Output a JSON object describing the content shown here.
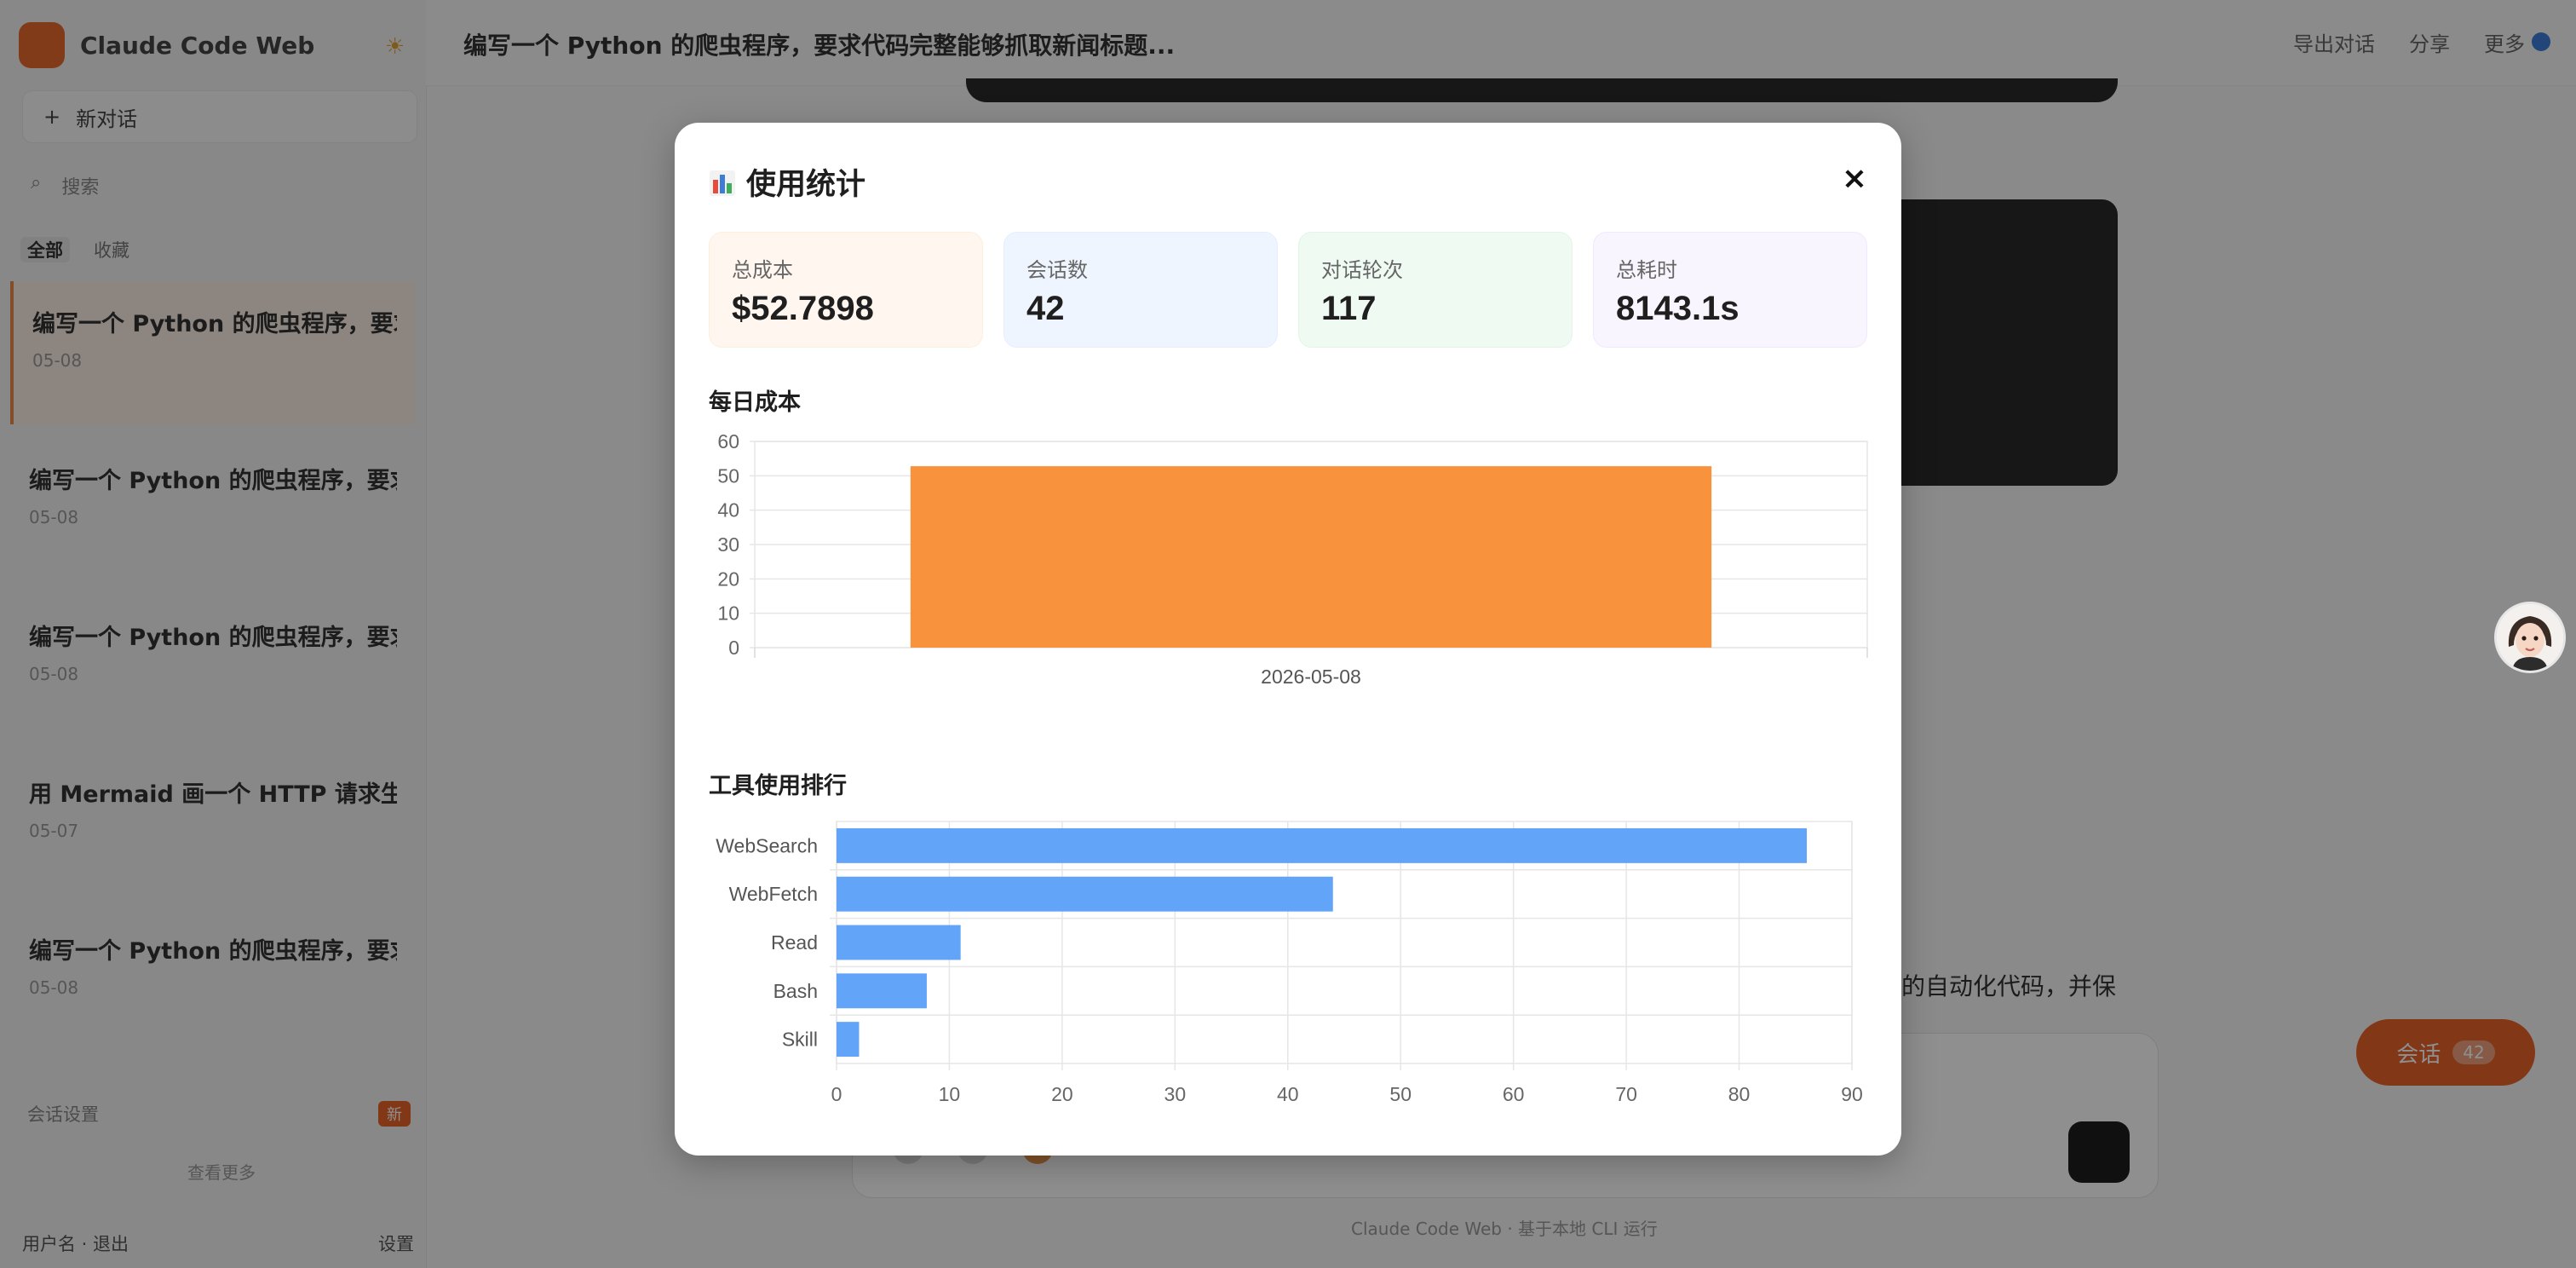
{
  "sidebar": {
    "app_name": "Claude Code Web",
    "new_chat_label": "新对话",
    "search_placeholder": "搜索",
    "filters": [
      "全部",
      "收藏"
    ],
    "sessions": [
      {
        "title": "编写一个 Python 的爬虫程序，要求",
        "time": "05-08"
      },
      {
        "title": "编写一个 Python 的爬虫程序，要求",
        "time": "05-08"
      },
      {
        "title": "编写一个 Python 的爬虫程序，要求",
        "time": "05-08"
      },
      {
        "title": "用 Mermaid 画一个 HTTP 请求生",
        "time": "05-07"
      },
      {
        "title": "编写一个 Python 的爬虫程序，要求",
        "time": "05-08"
      }
    ],
    "footer_label": "会话设置",
    "footer_badge": "新",
    "footer_link": "查看更多",
    "bottom_left": "用户名 · 退出",
    "bottom_right": "设置"
  },
  "header": {
    "conversation_title": "编写一个 Python 的爬虫程序，要求代码完整能够抓取新闻标题...",
    "actions": [
      "导出对话",
      "分享",
      "更多"
    ]
  },
  "main": {
    "background_snippet": "的自动化代码，并保",
    "bottom_hint": "Claude Code Web · 基于本地 CLI 运行",
    "float_button_label": "会话",
    "float_button_count": "42"
  },
  "modal": {
    "title": "使用统计",
    "close_label": "×",
    "cards": [
      {
        "label": "总成本",
        "value": "$52.7898",
        "bg": "#fff7ef",
        "border": "#fdeede"
      },
      {
        "label": "会话数",
        "value": "42",
        "bg": "#eff5ff",
        "border": "#e4eeff"
      },
      {
        "label": "对话轮次",
        "value": "117",
        "bg": "#effaf2",
        "border": "#e2f5e7"
      },
      {
        "label": "总耗时",
        "value": "8143.1s",
        "bg": "#f9f5ff",
        "border": "#f0e9fd"
      }
    ],
    "daily_cost_title": "每日成本",
    "tool_rank_title": "工具使用排行"
  },
  "chart_data": [
    {
      "type": "bar",
      "title": "每日成本",
      "categories": [
        "2026-05-08"
      ],
      "values": [
        52.79
      ],
      "ylim": [
        0,
        60
      ],
      "yticks": [
        0,
        10,
        20,
        30,
        40,
        50,
        60
      ],
      "color": "#f9923c",
      "grid": true
    },
    {
      "type": "bar",
      "orientation": "horizontal",
      "title": "工具使用排行",
      "categories": [
        "WebSearch",
        "WebFetch",
        "Read",
        "Bash",
        "Skill"
      ],
      "values": [
        86,
        44,
        11,
        8,
        2
      ],
      "xlim": [
        0,
        90
      ],
      "xticks": [
        0,
        10,
        20,
        30,
        40,
        50,
        60,
        70,
        80,
        90
      ],
      "color": "#62a4f7",
      "grid": true
    }
  ]
}
